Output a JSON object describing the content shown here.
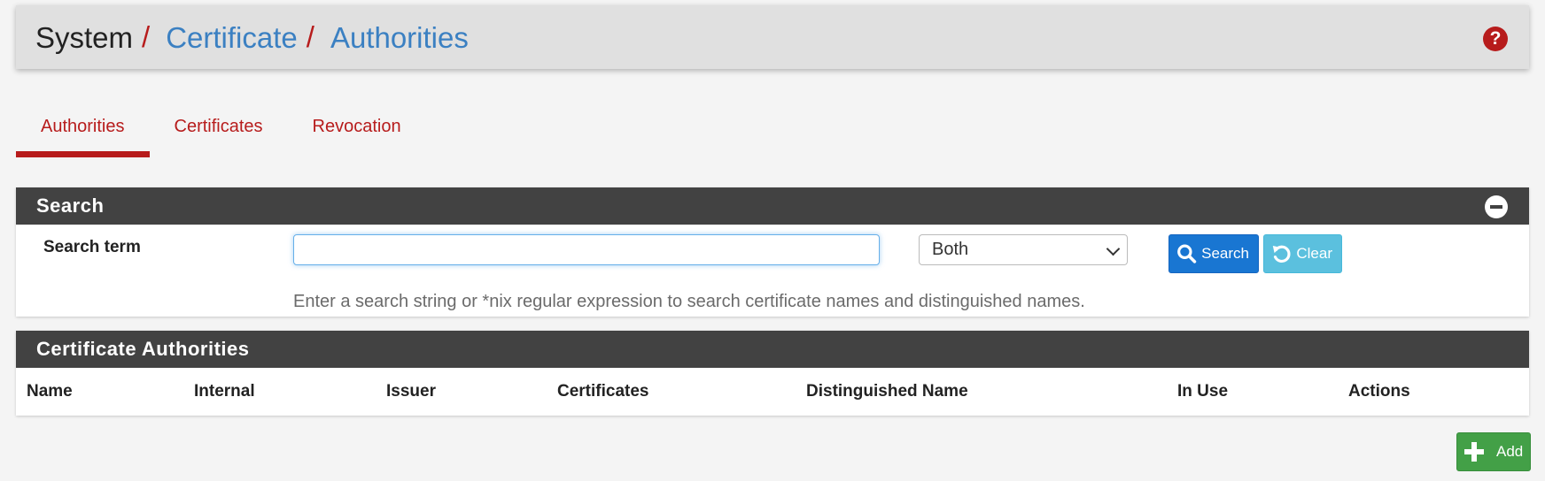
{
  "breadcrumb": {
    "items": [
      "System",
      "Certificate",
      "Authorities"
    ],
    "separator": "/"
  },
  "help_icon": "question-circle-icon",
  "tabs": [
    {
      "label": "Authorities",
      "active": true
    },
    {
      "label": "Certificates",
      "active": false
    },
    {
      "label": "Revocation",
      "active": false
    }
  ],
  "search_panel": {
    "title": "Search",
    "label": "Search term",
    "input_value": "",
    "select_value": "Both",
    "search_button": "Search",
    "clear_button": "Clear",
    "help_text": "Enter a search string or *nix regular expression to search certificate names and distinguished names."
  },
  "ca_panel": {
    "title": "Certificate Authorities",
    "columns": [
      "Name",
      "Internal",
      "Issuer",
      "Certificates",
      "Distinguished Name",
      "In Use",
      "Actions"
    ]
  },
  "add_button": "Add",
  "colors": {
    "accent_red": "#b71c1c",
    "link_blue": "#3b80c2",
    "panel_header": "#424242",
    "search_blue": "#1976d2",
    "clear_cyan": "#5bc0de",
    "add_green": "#43a047"
  }
}
